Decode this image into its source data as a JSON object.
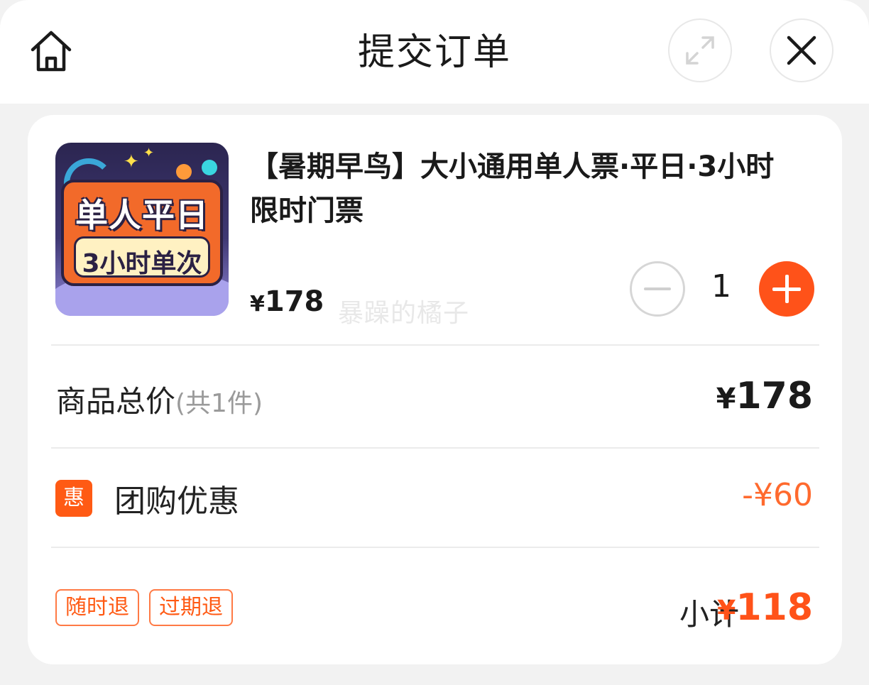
{
  "header": {
    "title": "提交订单",
    "home_icon": "home-icon",
    "expand_icon": "expand-icon",
    "close_icon": "close-icon"
  },
  "product": {
    "name": "【暑期早鸟】大小通用单人票·平日·3小时限时门票",
    "thumbnail": {
      "line1": "单人平日",
      "line2": "3小时单次"
    },
    "currency": "¥",
    "price": "178",
    "watermark": "暴躁的橘子",
    "quantity": "1"
  },
  "summary": {
    "total_label": "商品总价",
    "total_count": "(共1件)",
    "total_currency": "¥",
    "total_value": "178",
    "discount_icon": "惠",
    "discount_label": "团购优惠",
    "discount_value": "-¥60",
    "tags": [
      "随时退",
      "过期退"
    ],
    "subtotal_label": "小计",
    "subtotal_currency": "¥",
    "subtotal_value": "118"
  },
  "colors": {
    "accent": "#ff5219",
    "discount": "#ff6a2e"
  }
}
